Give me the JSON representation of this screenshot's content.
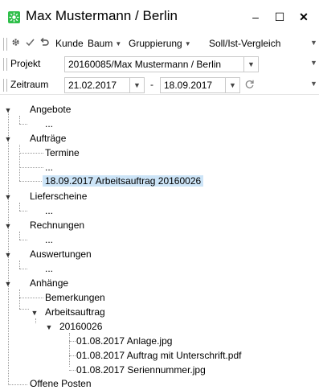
{
  "window": {
    "title": "Max Mustermann / Berlin",
    "minimize": "–",
    "maximize": "☐",
    "close": "✕"
  },
  "toolbar": {
    "items": [
      {
        "label": "Kunde"
      },
      {
        "label": "Baum",
        "dropdown": true
      },
      {
        "label": "Gruppierung",
        "dropdown": true
      },
      {
        "label": "Soll/Ist-Vergleich"
      }
    ]
  },
  "projekt": {
    "label": "Projekt",
    "value": "20160085/Max Mustermann / Berlin"
  },
  "zeitraum": {
    "label": "Zeitraum",
    "from": "21.02.2017",
    "separator": "-",
    "to": "18.09.2017"
  },
  "tree": {
    "angebote": "Angebote",
    "angebote_child": "...",
    "auftraege": "Aufträge",
    "termine": "Termine",
    "auftraege_dots": "...",
    "arbeitsauftrag_selected": "18.09.2017 Arbeitsauftrag 20160026",
    "lieferscheine": "Lieferscheine",
    "lieferscheine_child": "...",
    "rechnungen": "Rechnungen",
    "rechnungen_child": "...",
    "auswertungen": "Auswertungen",
    "auswertungen_child": "...",
    "anhaenge": "Anhänge",
    "bemerkungen": "Bemerkungen",
    "arbeitsauftrag": "Arbeitsauftrag",
    "nr": "20160026",
    "file1": "01.08.2017 Anlage.jpg",
    "file2": "01.08.2017 Auftrag mit Unterschrift.pdf",
    "file3": "01.08.2017 Seriennummer.jpg",
    "offene_posten": "Offene Posten"
  },
  "colors": {
    "selection": "#cce4f7",
    "app_icon": "#2fbf4a"
  }
}
